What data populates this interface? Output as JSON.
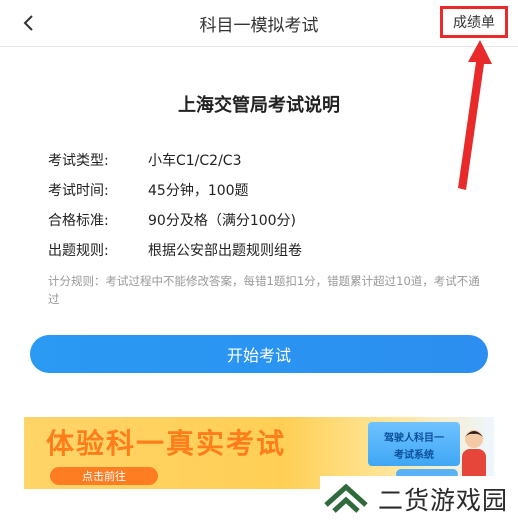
{
  "header": {
    "title": "科目一模拟考试",
    "score_label": "成绩单",
    "annotation_color": "#e82a2a"
  },
  "page": {
    "title": "上海交管局考试说明",
    "info": [
      {
        "key": "考试类型:",
        "value": "小车C1/C2/C3"
      },
      {
        "key": "考试时间:",
        "value": "45分钟，100题"
      },
      {
        "key": "合格标准:",
        "value": "90分及格（满分100分)"
      },
      {
        "key": "出题规则:",
        "value": "根据公安部出题规则组卷"
      }
    ],
    "note": "计分规则：考试过程中不能修改答案，每错1题扣1分，错题累计超过10道，考试不通过",
    "start_label": "开始考试",
    "accent_color": "#2b95f2"
  },
  "banner": {
    "title": "体验科一真实考试",
    "button_label": "点击前往",
    "card_line1": "驾驶人科目一",
    "card_line2": "考试系统"
  },
  "watermark": {
    "text": "二货游戏园"
  }
}
